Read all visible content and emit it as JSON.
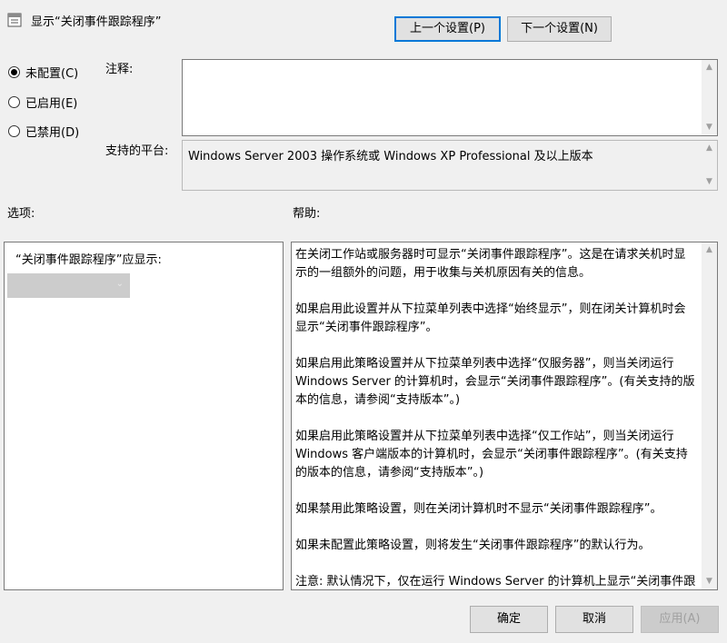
{
  "title": "显示“关闭事件跟踪程序”",
  "buttons": {
    "prev": "上一个设置(P)",
    "next": "下一个设置(N)",
    "ok": "确定",
    "cancel": "取消",
    "apply": "应用(A)"
  },
  "radios": [
    {
      "label": "未配置(C)",
      "checked": true
    },
    {
      "label": "已启用(E)",
      "checked": false
    },
    {
      "label": "已禁用(D)",
      "checked": false
    }
  ],
  "comment_label": "注释:",
  "platform_label": "支持的平台:",
  "platform_value": "Windows Server 2003 操作系统或 Windows XP Professional 及以上版本",
  "options_label": "选项:",
  "help_label": "帮助:",
  "option_prompt": "“关闭事件跟踪程序”应显示:",
  "help_paragraphs": [
    "在关闭工作站或服务器时可显示“关闭事件跟踪程序”。这是在请求关机时显示的一组额外的问题，用于收集与关机原因有关的信息。",
    "如果启用此设置并从下拉菜单列表中选择“始终显示”，则在闭关计算机时会显示“关闭事件跟踪程序”。",
    "如果启用此策略设置并从下拉菜单列表中选择“仅服务器”，则当关闭运行 Windows Server 的计算机时，会显示“关闭事件跟踪程序”。(有关支持的版本的信息，请参阅“支持版本”。)",
    "如果启用此策略设置并从下拉菜单列表中选择“仅工作站”，则当关闭运行 Windows 客户端版本的计算机时，会显示“关闭事件跟踪程序”。(有关支持的版本的信息，请参阅“支持版本”。)",
    "如果禁用此策略设置，则在关闭计算机时不显示“关闭事件跟踪程序”。",
    "如果未配置此策略设置，则将发生“关闭事件跟踪程序”的默认行为。",
    "注意: 默认情况下，仅在运行 Windows Server 的计算机上显示“关闭事件跟踪程序”。"
  ],
  "colors": {
    "focus_border": "#0078d7",
    "window_bg": "#f0f0f0"
  }
}
